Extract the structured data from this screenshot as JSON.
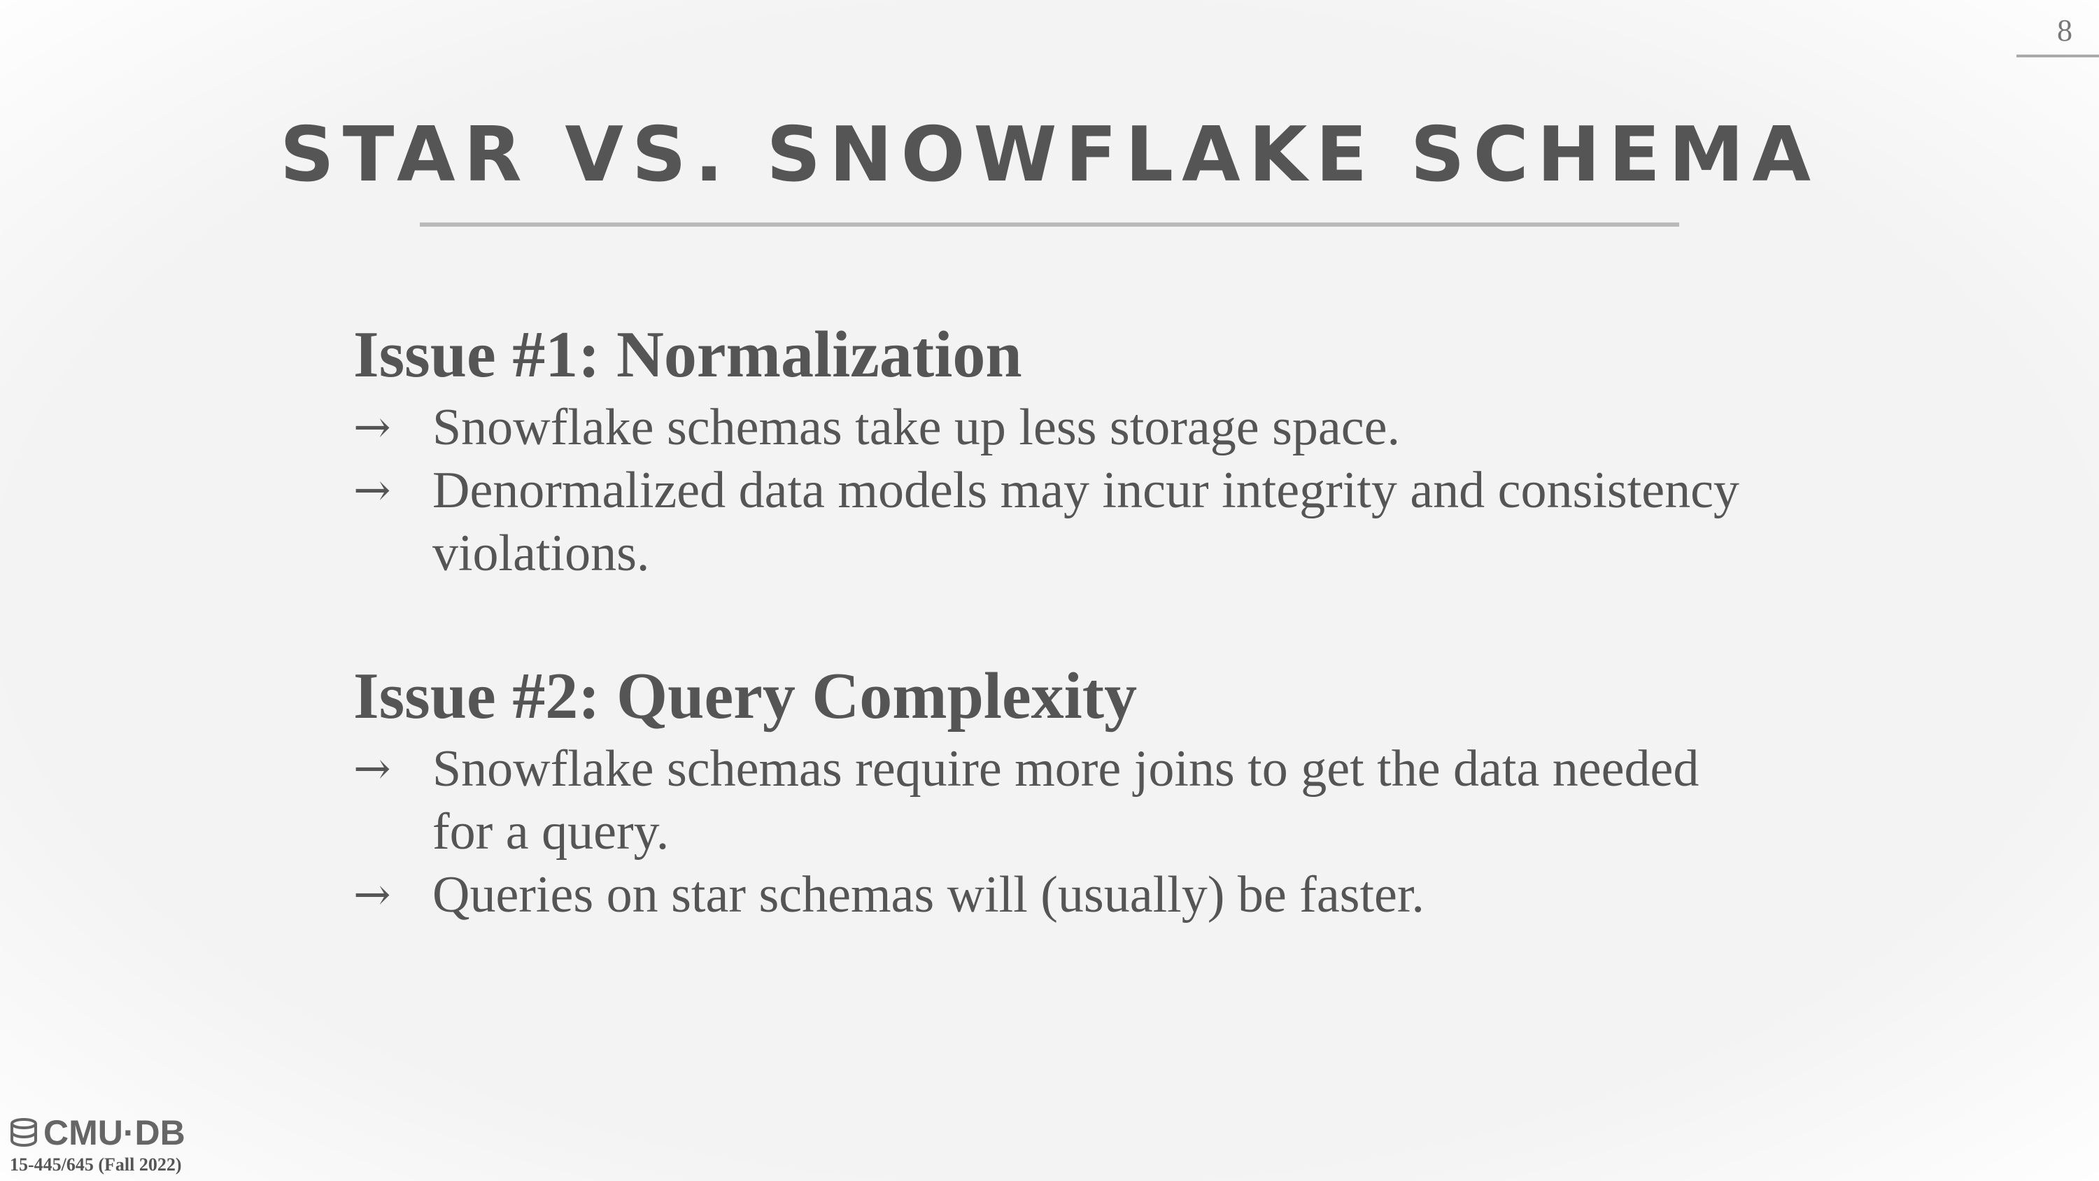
{
  "page": {
    "number": "8"
  },
  "slide": {
    "title": "STAR VS. SNOWFLAKE SCHEMA",
    "sections": [
      {
        "heading": "Issue #1: Normalization",
        "bullets": [
          "Snowflake schemas take up less storage space.",
          "Denormalized data models may incur integrity and consistency violations."
        ]
      },
      {
        "heading": "Issue #2: Query Complexity",
        "bullets": [
          "Snowflake schemas require more joins to get the data needed for a query.",
          "Queries on star schemas will (usually) be faster."
        ]
      }
    ],
    "bullet_marker": "→"
  },
  "footer": {
    "logo_text": "CMU·DB",
    "logo_icon": "database-icon",
    "course": "15-445/645 (Fall 2022)"
  },
  "colors": {
    "background": "#f3f3f3",
    "text": "#555555",
    "rule": "#b9b9b9"
  }
}
